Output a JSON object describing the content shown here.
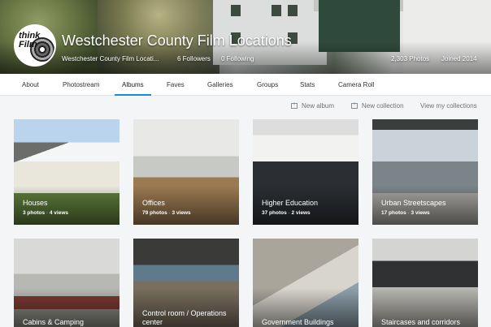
{
  "profile": {
    "title": "Westchester County Film Locations",
    "subtitle": "Westchester County Film Locati...",
    "followers": "6 Followers",
    "following": "0 Following",
    "photos": "2,303 Photos",
    "joined": "Joined 2014",
    "avatar_text": "think Film"
  },
  "tabs": [
    {
      "label": "About",
      "active": false
    },
    {
      "label": "Photostream",
      "active": false
    },
    {
      "label": "Albums",
      "active": true
    },
    {
      "label": "Faves",
      "active": false
    },
    {
      "label": "Galleries",
      "active": false
    },
    {
      "label": "Groups",
      "active": false
    },
    {
      "label": "Stats",
      "active": false
    },
    {
      "label": "Camera Roll",
      "active": false
    }
  ],
  "actions": {
    "new_album": "New album",
    "new_collection": "New collection",
    "view_collections": "View my collections"
  },
  "albums": [
    {
      "name": "Houses",
      "photos": "3 photos",
      "views": "4 views"
    },
    {
      "name": "Offices",
      "photos": "79 photos",
      "views": "3 views"
    },
    {
      "name": "Higher Education",
      "photos": "37 photos",
      "views": "2 views"
    },
    {
      "name": "Urban Streetscapes",
      "photos": "17 photos",
      "views": "3 views"
    },
    {
      "name": "Cabins & Camping"
    },
    {
      "name": "Control room / Operations center"
    },
    {
      "name": "Government Buildings"
    },
    {
      "name": "Staircases and corridors"
    }
  ],
  "icons": {
    "new_album": "plus-box-icon",
    "new_collection": "plus-box-icon"
  },
  "colors": {
    "accent": "#128fdc",
    "page_bg": "#f3f5f6"
  }
}
